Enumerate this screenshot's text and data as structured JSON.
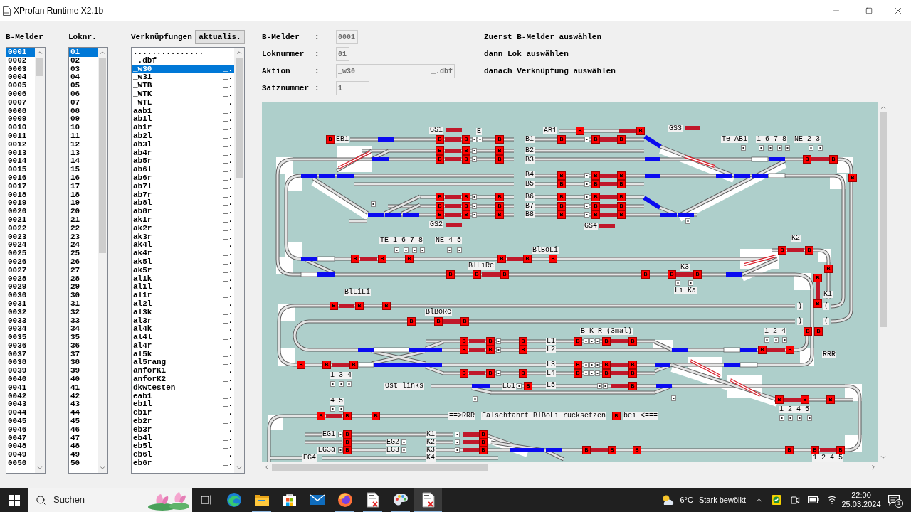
{
  "window": {
    "title": "XProfan Runtime X2.1b"
  },
  "lists": [
    {
      "heading": "B-Melder",
      "items": [
        {
          "text": "0001",
          "selected": true
        },
        {
          "text": "0002",
          "selected": false
        },
        {
          "text": "0003",
          "selected": false
        },
        {
          "text": "0004",
          "selected": false
        },
        {
          "text": "0005",
          "selected": false
        },
        {
          "text": "0006",
          "selected": false
        },
        {
          "text": "0007",
          "selected": false
        },
        {
          "text": "0008",
          "selected": false
        },
        {
          "text": "0009",
          "selected": false
        },
        {
          "text": "0010",
          "selected": false
        },
        {
          "text": "0011",
          "selected": false
        },
        {
          "text": "0012",
          "selected": false
        },
        {
          "text": "0013",
          "selected": false
        },
        {
          "text": "0014",
          "selected": false
        },
        {
          "text": "0015",
          "selected": false
        },
        {
          "text": "0016",
          "selected": false
        },
        {
          "text": "0017",
          "selected": false
        },
        {
          "text": "0018",
          "selected": false
        },
        {
          "text": "0019",
          "selected": false
        },
        {
          "text": "0020",
          "selected": false
        },
        {
          "text": "0021",
          "selected": false
        },
        {
          "text": "0022",
          "selected": false
        },
        {
          "text": "0023",
          "selected": false
        },
        {
          "text": "0024",
          "selected": false
        },
        {
          "text": "0025",
          "selected": false
        },
        {
          "text": "0026",
          "selected": false
        },
        {
          "text": "0027",
          "selected": false
        },
        {
          "text": "0028",
          "selected": false
        },
        {
          "text": "0029",
          "selected": false
        },
        {
          "text": "0030",
          "selected": false
        },
        {
          "text": "0031",
          "selected": false
        },
        {
          "text": "0032",
          "selected": false
        },
        {
          "text": "0033",
          "selected": false
        },
        {
          "text": "0034",
          "selected": false
        },
        {
          "text": "0035",
          "selected": false
        },
        {
          "text": "0036",
          "selected": false
        },
        {
          "text": "0037",
          "selected": false
        },
        {
          "text": "0038",
          "selected": false
        },
        {
          "text": "0039",
          "selected": false
        },
        {
          "text": "0040",
          "selected": false
        },
        {
          "text": "0041",
          "selected": false
        },
        {
          "text": "0042",
          "selected": false
        },
        {
          "text": "0043",
          "selected": false
        },
        {
          "text": "0044",
          "selected": false
        },
        {
          "text": "0045",
          "selected": false
        },
        {
          "text": "0046",
          "selected": false
        },
        {
          "text": "0047",
          "selected": false
        },
        {
          "text": "0048",
          "selected": false
        },
        {
          "text": "0049",
          "selected": false
        },
        {
          "text": "0050",
          "selected": false
        }
      ]
    },
    {
      "heading": "Loknr.",
      "items": [
        {
          "text": "01",
          "selected": true
        },
        {
          "text": "02",
          "selected": false
        },
        {
          "text": "03",
          "selected": false
        },
        {
          "text": "04",
          "selected": false
        },
        {
          "text": "05",
          "selected": false
        },
        {
          "text": "06",
          "selected": false
        },
        {
          "text": "07",
          "selected": false
        },
        {
          "text": "08",
          "selected": false
        },
        {
          "text": "09",
          "selected": false
        },
        {
          "text": "10",
          "selected": false
        },
        {
          "text": "11",
          "selected": false
        },
        {
          "text": "12",
          "selected": false
        },
        {
          "text": "13",
          "selected": false
        },
        {
          "text": "14",
          "selected": false
        },
        {
          "text": "15",
          "selected": false
        },
        {
          "text": "16",
          "selected": false
        },
        {
          "text": "17",
          "selected": false
        },
        {
          "text": "18",
          "selected": false
        },
        {
          "text": "19",
          "selected": false
        },
        {
          "text": "20",
          "selected": false
        },
        {
          "text": "21",
          "selected": false
        },
        {
          "text": "22",
          "selected": false
        },
        {
          "text": "23",
          "selected": false
        },
        {
          "text": "24",
          "selected": false
        },
        {
          "text": "25",
          "selected": false
        },
        {
          "text": "26",
          "selected": false
        },
        {
          "text": "27",
          "selected": false
        },
        {
          "text": "28",
          "selected": false
        },
        {
          "text": "29",
          "selected": false
        },
        {
          "text": "30",
          "selected": false
        },
        {
          "text": "31",
          "selected": false
        },
        {
          "text": "32",
          "selected": false
        },
        {
          "text": "33",
          "selected": false
        },
        {
          "text": "34",
          "selected": false
        },
        {
          "text": "35",
          "selected": false
        },
        {
          "text": "36",
          "selected": false
        },
        {
          "text": "37",
          "selected": false
        },
        {
          "text": "38",
          "selected": false
        },
        {
          "text": "39",
          "selected": false
        },
        {
          "text": "40",
          "selected": false
        },
        {
          "text": "41",
          "selected": false
        },
        {
          "text": "42",
          "selected": false
        },
        {
          "text": "43",
          "selected": false
        },
        {
          "text": "44",
          "selected": false
        },
        {
          "text": "45",
          "selected": false
        },
        {
          "text": "46",
          "selected": false
        },
        {
          "text": "47",
          "selected": false
        },
        {
          "text": "48",
          "selected": false
        },
        {
          "text": "49",
          "selected": false
        },
        {
          "text": "50",
          "selected": false
        }
      ]
    },
    {
      "heading": "Verknüpfungen",
      "button": "aktualis.",
      "items": [
        {
          "text": "...............",
          "selected": false
        },
        {
          "text": "_.dbf",
          "selected": false
        },
        {
          "text": "_w30",
          "suffix": "_.",
          "selected": true
        },
        {
          "text": "_w31",
          "suffix": "_.",
          "selected": false
        },
        {
          "text": "_WTB",
          "suffix": "_.",
          "selected": false
        },
        {
          "text": "_WTK",
          "suffix": "_.",
          "selected": false
        },
        {
          "text": "_WTL",
          "suffix": "_.",
          "selected": false
        },
        {
          "text": "aab1",
          "suffix": "_.",
          "selected": false
        },
        {
          "text": "ab1l",
          "suffix": "_.",
          "selected": false
        },
        {
          "text": "ab1r",
          "suffix": "_.",
          "selected": false
        },
        {
          "text": "ab2l",
          "suffix": "_.",
          "selected": false
        },
        {
          "text": "ab3l",
          "suffix": "_.",
          "selected": false
        },
        {
          "text": "ab4r",
          "suffix": "_.",
          "selected": false
        },
        {
          "text": "ab5r",
          "suffix": "_.",
          "selected": false
        },
        {
          "text": "ab6l",
          "suffix": "_.",
          "selected": false
        },
        {
          "text": "ab6r",
          "suffix": "_.",
          "selected": false
        },
        {
          "text": "ab7l",
          "suffix": "_.",
          "selected": false
        },
        {
          "text": "ab7r",
          "suffix": "_.",
          "selected": false
        },
        {
          "text": "ab8l",
          "suffix": "_.",
          "selected": false
        },
        {
          "text": "ab8r",
          "suffix": "_.",
          "selected": false
        },
        {
          "text": "ak1r",
          "suffix": "_.",
          "selected": false
        },
        {
          "text": "ak2r",
          "suffix": "_.",
          "selected": false
        },
        {
          "text": "ak3r",
          "suffix": "_.",
          "selected": false
        },
        {
          "text": "ak4l",
          "suffix": "_.",
          "selected": false
        },
        {
          "text": "ak4r",
          "suffix": "_.",
          "selected": false
        },
        {
          "text": "ak5l",
          "suffix": "_.",
          "selected": false
        },
        {
          "text": "ak5r",
          "suffix": "_.",
          "selected": false
        },
        {
          "text": "al1k",
          "suffix": "_.",
          "selected": false
        },
        {
          "text": "al1l",
          "suffix": "_.",
          "selected": false
        },
        {
          "text": "al1r",
          "suffix": "_.",
          "selected": false
        },
        {
          "text": "al2l",
          "suffix": "_.",
          "selected": false
        },
        {
          "text": "al3k",
          "suffix": "_.",
          "selected": false
        },
        {
          "text": "al3r",
          "suffix": "_.",
          "selected": false
        },
        {
          "text": "al4k",
          "suffix": "_.",
          "selected": false
        },
        {
          "text": "al4l",
          "suffix": "_.",
          "selected": false
        },
        {
          "text": "al4r",
          "suffix": "_.",
          "selected": false
        },
        {
          "text": "al5k",
          "suffix": "_.",
          "selected": false
        },
        {
          "text": "al5rang",
          "suffix": "_.",
          "selected": false
        },
        {
          "text": "anforK1",
          "suffix": "_.",
          "selected": false
        },
        {
          "text": "anforK2",
          "suffix": "_.",
          "selected": false
        },
        {
          "text": "dkwtesten",
          "suffix": "_.",
          "selected": false
        },
        {
          "text": "eab1",
          "suffix": "_.",
          "selected": false
        },
        {
          "text": "eb1l",
          "suffix": "_.",
          "selected": false
        },
        {
          "text": "eb1r",
          "suffix": "_.",
          "selected": false
        },
        {
          "text": "eb2r",
          "suffix": "_.",
          "selected": false
        },
        {
          "text": "eb3r",
          "suffix": "_.",
          "selected": false
        },
        {
          "text": "eb4l",
          "suffix": "_.",
          "selected": false
        },
        {
          "text": "eb5l",
          "suffix": "_.",
          "selected": false
        },
        {
          "text": "eb6l",
          "suffix": "_.",
          "selected": false
        },
        {
          "text": "eb6r",
          "suffix": "_.",
          "selected": false
        }
      ]
    }
  ],
  "info": {
    "rows": [
      {
        "label": "B-Melder",
        "separator": ":",
        "value": "0001"
      },
      {
        "label": "Loknummer",
        "separator": ":",
        "value": "01"
      },
      {
        "label": "Aktion",
        "separator": ":",
        "value": "_w30",
        "suffix": "_.dbf"
      },
      {
        "label": "Satznummer",
        "separator": ":",
        "value": "1"
      }
    ],
    "hints": [
      "Zuerst B-Melder auswählen",
      "dann Lok auswählen",
      "danach Verknüpfung auswählen"
    ]
  },
  "track_plan": {
    "labels": [
      "EB1",
      "GS1",
      "E",
      "B1",
      "AB1",
      "GS3",
      "B2",
      "B3",
      "Te AB1",
      "1 6 7 8",
      "NE 2 3",
      "B4",
      "B5",
      "B6",
      "B7",
      "B8",
      "GS2",
      "GS4",
      "TE 1 6 7 8",
      "NE 4 5",
      "K2",
      "BlBoLi",
      "BlLiRe",
      "K3",
      "Li Ka",
      "BlLiLi",
      "K1",
      ")",
      "(",
      "BlBoRe",
      ")",
      "(",
      "B K R (3mal)",
      "1 2 4",
      "L1",
      "L2",
      "RRR",
      "L3",
      "L4",
      "1 3 4",
      "Ost links",
      "EG1",
      "L5",
      "4 5",
      "1 2 4 5",
      "==>RRR",
      "Falschfahrt BlBoLi rücksetzen",
      "bei <===",
      "EG1",
      "K1",
      "EG2",
      "K2",
      "EG3a",
      "EG3",
      "K3",
      "EG4",
      "K4",
      "1 2 4 5"
    ],
    "sensors": [
      "B",
      "B",
      "B",
      "B",
      "B",
      "B",
      "B",
      "B",
      "B",
      "B",
      "B",
      "B",
      "B",
      "B",
      "B",
      "B",
      "B",
      "B",
      "B",
      "B",
      "B",
      "B",
      "B",
      "B",
      "B",
      "B",
      "B",
      "B",
      "B",
      "B",
      "B",
      "B",
      "B",
      "B",
      "B",
      "B",
      "B",
      "B",
      "B",
      "B",
      "B",
      "B",
      "B",
      "B",
      "B",
      "B",
      "B",
      "B",
      "B",
      "B",
      "B",
      "B",
      "B",
      "B",
      "B",
      "B",
      "B",
      "B",
      "B",
      "B",
      "B",
      "B",
      "B",
      "B",
      "B",
      "B",
      "B",
      "B",
      "B",
      "B",
      "B",
      "B",
      "B",
      "B",
      "B",
      "B",
      "B",
      "B",
      "B",
      "B",
      "B",
      "B",
      "B",
      "B",
      "B",
      "B",
      "B",
      "B",
      "B",
      "B",
      "B",
      "B",
      "B",
      "B",
      "B",
      "B",
      "B",
      "B",
      "B",
      "B",
      "B",
      "B",
      "B",
      "B",
      "B",
      "B",
      "B",
      "B",
      "B",
      "B",
      "B"
    ]
  },
  "taskbar": {
    "search": {
      "placeholder": "Suchen"
    },
    "apps": [
      {
        "kind": "taskview",
        "running": false,
        "selected": false
      },
      {
        "kind": "swirl",
        "running": false,
        "selected": false
      },
      {
        "kind": "folder",
        "running": true,
        "selected": false
      },
      {
        "kind": "store",
        "running": false,
        "selected": false
      },
      {
        "kind": "mail",
        "running": false,
        "selected": false
      },
      {
        "kind": "firefox",
        "running": true,
        "selected": false
      },
      {
        "kind": "document",
        "running": true,
        "selected": false
      },
      {
        "kind": "palette",
        "running": true,
        "selected": false
      },
      {
        "kind": "document",
        "running": true,
        "selected": true
      }
    ],
    "weather": {
      "temperature": "6°C",
      "condition": "Stark bewölkt"
    },
    "clock": {
      "time": "22:00",
      "date": "25.03.2024"
    },
    "notifications": {
      "count": "1"
    }
  }
}
